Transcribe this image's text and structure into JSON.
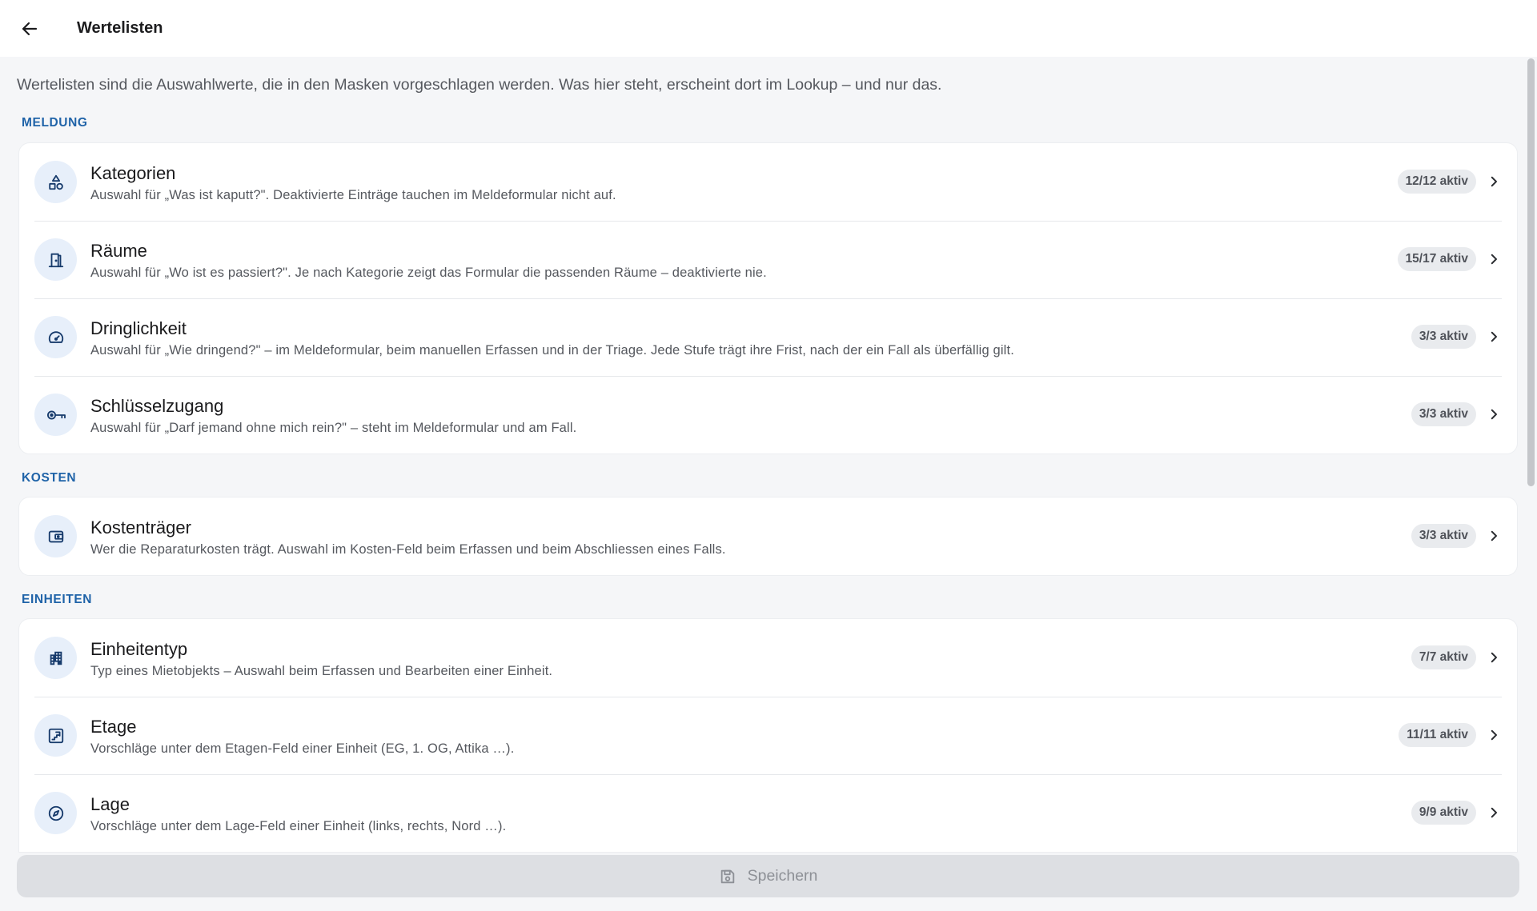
{
  "header": {
    "title": "Wertelisten",
    "back_icon": "arrow-left-icon"
  },
  "intro": "Wertelisten sind die Auswahlwerte, die in den Masken vorgeschlagen werden. Was hier steht, erscheint dort im Lookup – und nur das.",
  "colors": {
    "accent": "#1f63a8",
    "icon_bg": "#e7effa",
    "icon_fg": "#163a6b",
    "badge_bg": "#e9ebee",
    "page_bg": "#f5f6f8"
  },
  "sections": [
    {
      "label": "MELDUNG",
      "items": [
        {
          "title": "Kategorien",
          "desc": "Auswahl für „Was ist kaputt?\". Deaktivierte Einträge tauchen im Meldeformular nicht auf.",
          "badge": "12/12 aktiv",
          "icon": "shapes-icon"
        },
        {
          "title": "Räume",
          "desc": "Auswahl für „Wo ist es passiert?\". Je nach Kategorie zeigt das Formular die passenden Räume – deaktivierte nie.",
          "badge": "15/17 aktiv",
          "icon": "door-icon"
        },
        {
          "title": "Dringlichkeit",
          "desc": "Auswahl für „Wie dringend?\" – im Meldeformular, beim manuellen Erfassen und in der Triage. Jede Stufe trägt ihre Frist, nach der ein Fall als überfällig gilt.",
          "badge": "3/3 aktiv",
          "icon": "speedometer-icon"
        },
        {
          "title": "Schlüsselzugang",
          "desc": "Auswahl für „Darf jemand ohne mich rein?\" – steht im Meldeformular und am Fall.",
          "badge": "3/3 aktiv",
          "icon": "key-icon"
        }
      ]
    },
    {
      "label": "KOSTEN",
      "items": [
        {
          "title": "Kostenträger",
          "desc": "Wer die Reparaturkosten trägt. Auswahl im Kosten-Feld beim Erfassen und beim Abschliessen eines Falls.",
          "badge": "3/3 aktiv",
          "icon": "wallet-icon"
        }
      ]
    },
    {
      "label": "EINHEITEN",
      "items": [
        {
          "title": "Einheitentyp",
          "desc": "Typ eines Mietobjekts – Auswahl beim Erfassen und Bearbeiten einer Einheit.",
          "badge": "7/7 aktiv",
          "icon": "building-icon"
        },
        {
          "title": "Etage",
          "desc": "Vorschläge unter dem Etagen-Feld einer Einheit (EG, 1. OG, Attika …).",
          "badge": "11/11 aktiv",
          "icon": "stairs-icon"
        },
        {
          "title": "Lage",
          "desc": "Vorschläge unter dem Lage-Feld einer Einheit (links, rechts, Nord …).",
          "badge": "9/9 aktiv",
          "icon": "compass-icon"
        }
      ]
    }
  ],
  "footer": {
    "save_label": "Speichern",
    "save_icon": "save-icon"
  }
}
